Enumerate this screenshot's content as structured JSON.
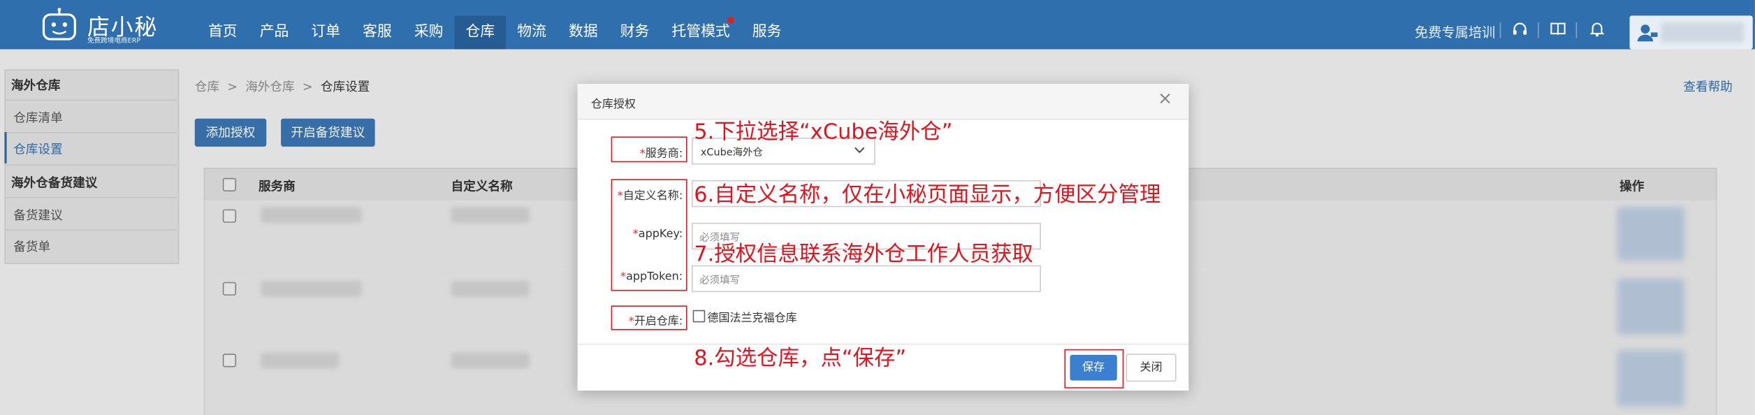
{
  "app": {
    "logo_text": "店小秘",
    "logo_sub": "免费跨境电商ERP"
  },
  "nav": {
    "items": [
      "首页",
      "产品",
      "订单",
      "客服",
      "采购",
      "仓库",
      "物流",
      "数据",
      "财务",
      "托管模式",
      "服务"
    ],
    "active": "仓库",
    "training": "免费专属培训"
  },
  "sidebar": {
    "group1": "海外仓库",
    "item1": "仓库清单",
    "item2": "仓库设置",
    "group2": "海外仓备货建议",
    "item3": "备货建议",
    "item4": "备货单"
  },
  "breadcrumb": {
    "a": "仓库",
    "b": "海外仓库",
    "c": "仓库设置",
    "sep": ">"
  },
  "help_link": "查看帮助",
  "toolbar": {
    "add_auth": "添加授权",
    "enable_stock": "开启备货建议"
  },
  "table": {
    "col_provider": "服务商",
    "col_custom_name": "自定义名称",
    "col_actions": "操作"
  },
  "modal": {
    "title": "仓库授权",
    "provider_label": "服务商:",
    "provider_value": "xCube海外仓",
    "custom_name_label": "自定义名称:",
    "appkey_label": "appKey:",
    "appkey_placeholder": "必须填写",
    "apptoken_label": "appToken:",
    "apptoken_placeholder": "必须填写",
    "enable_label": "开启仓库:",
    "warehouse_option": "德国法兰克福仓库",
    "save": "保存",
    "close": "关闭"
  },
  "annotations": {
    "step5": "5.下拉选择“xCube海外仓”",
    "step6": "6.自定义名称，仅在小秘页面显示，方便区分管理",
    "step7": "7.授权信息联系海外仓工作人员获取",
    "step8": "8.勾选仓库，点“保存”"
  },
  "colors": {
    "nav_bg": "#2f6fad",
    "accent": "#3a7fd0",
    "annotation": "#e0141e"
  }
}
